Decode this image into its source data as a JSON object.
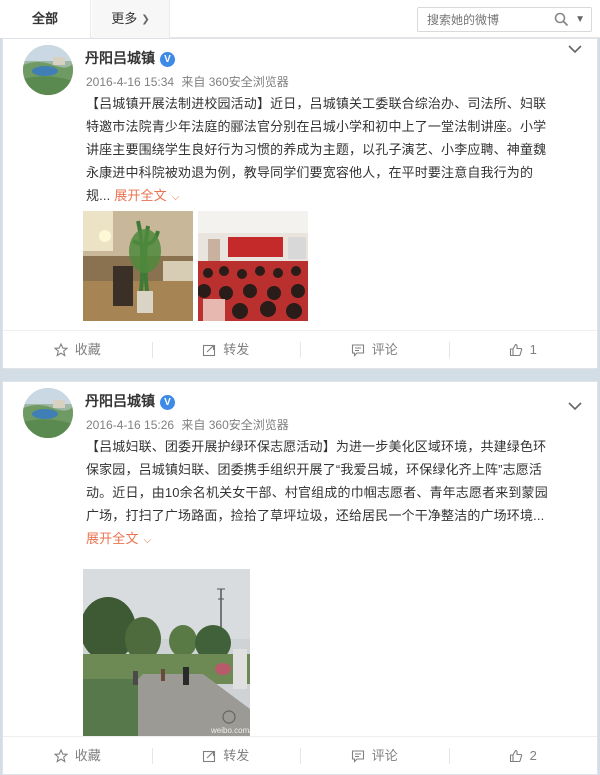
{
  "topbar": {
    "tab_all": "全部",
    "tab_more": "更多",
    "search_placeholder": "搜索她的微博"
  },
  "posts": [
    {
      "author": "丹阳吕城镇",
      "verified": "V",
      "time": "2016-4-16 15:34",
      "source": "来自 360安全浏览器",
      "lines": [
        "【吕城镇开展法制进校园活动】近日，吕城镇关工委联合综治办、司法所、妇联",
        "特邀市法院青少年法庭的郦法官分别在吕城小学和初中上了一堂法制讲座。小学",
        "讲座主要围绕学生良好行为习惯的养成为主题，以孔子演艺、小李应聘、神童魏",
        "永康进中科院被劝退为例，教导同学们要宽容他人，在平时要注意自我行为的",
        "规..."
      ],
      "expand": "展开全文",
      "actions": {
        "fav": "收藏",
        "repost": "转发",
        "comment": "评论",
        "like": "1"
      }
    },
    {
      "author": "丹阳吕城镇",
      "verified": "V",
      "time": "2016-4-16 15:26",
      "source": "来自 360安全浏览器",
      "lines": [
        "【吕城妇联、团委开展护绿环保志愿活动】为进一步美化区域环境，共建绿色环",
        "保家园，吕城镇妇联、团委携手组织开展了“我爱吕城，环保绿化齐上阵”志愿活",
        "动。近日，由10余名机关女干部、村官组成的巾帼志愿者、青年志愿者来到蒙园",
        "广场，打扫了广场路面，捡拾了草坪垃圾，还给居民一个干净整洁的广场环境..."
      ],
      "expand": "展开全文",
      "watermark": "weibo.com/u/532",
      "actions": {
        "fav": "收藏",
        "repost": "转发",
        "comment": "评论",
        "like": "2"
      }
    }
  ],
  "colors": {
    "accent": "#eb7350",
    "verified": "#3d8ae7",
    "page_bg": "#d3dde6"
  }
}
